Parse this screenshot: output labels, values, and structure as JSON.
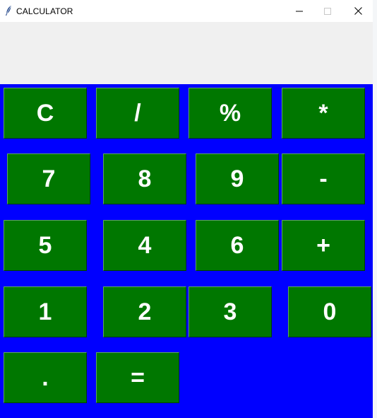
{
  "window": {
    "title": "CALCULATOR",
    "icon": "feather-icon",
    "controls": {
      "minimize": "minimize-icon",
      "maximize": "maximize-icon",
      "close": "close-icon"
    }
  },
  "display": {
    "value": ""
  },
  "colors": {
    "background": "#0000ff",
    "button": "#007700",
    "button_text": "#ffffff",
    "display": "#f0f0f0"
  },
  "keys": {
    "clear": "C",
    "divide": "/",
    "percent": "%",
    "multiply": "*",
    "seven": "7",
    "eight": "8",
    "nine": "9",
    "minus": "-",
    "five": "5",
    "four": "4",
    "six": "6",
    "plus": "+",
    "one": "1",
    "two": "2",
    "three": "3",
    "zero": "0",
    "decimal": ".",
    "equals": "="
  }
}
